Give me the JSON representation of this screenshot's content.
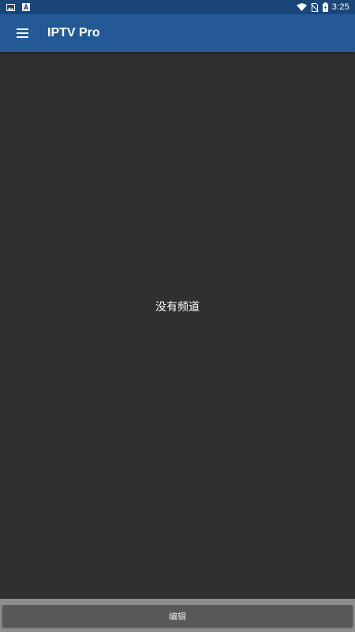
{
  "status_bar": {
    "time": "3:25",
    "left_icons": [
      "image-notification-icon",
      "a-notification-icon"
    ],
    "right_icons": [
      "wifi-icon",
      "no-sim-icon",
      "battery-charging-icon"
    ]
  },
  "app_bar": {
    "title": "IPTV Pro",
    "menu_icon": "hamburger-menu-icon",
    "color": "#235a96"
  },
  "main": {
    "empty_message": "没有频道"
  },
  "footer": {
    "edit_label": "编辑"
  }
}
